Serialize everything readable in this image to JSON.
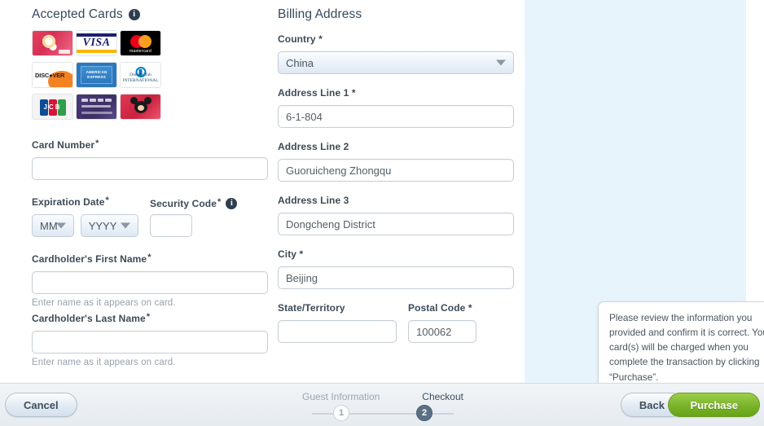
{
  "colors": {
    "accent_green": "#7db52e",
    "step_active": "#5b6f85",
    "panel_blue": "#e8f4fb",
    "label_text": "#3d4a56"
  },
  "payment": {
    "accepted_cards_title": "Accepted Cards",
    "accepted_cards_info_icon": "info-icon",
    "cards": [
      {
        "name": "disney-visa-card",
        "label": "Disney Visa"
      },
      {
        "name": "visa-card",
        "label": "VISA"
      },
      {
        "name": "mastercard-card",
        "label": "mastercard"
      },
      {
        "name": "discover-card",
        "label": "DISCOVER"
      },
      {
        "name": "american-express-card",
        "label": "AMERICAN EXPRESS"
      },
      {
        "name": "diners-club-card",
        "label": "Diners Club INTERNATIONAL"
      },
      {
        "name": "jcb-card",
        "label": "JCB"
      },
      {
        "name": "unionpay-disney-card",
        "label": "UnionPay Disney"
      },
      {
        "name": "disney-mickey-card",
        "label": "Disney Mickey"
      }
    ],
    "card_number_label": "Card Number",
    "card_number_value": "",
    "expiration_date_label": "Expiration Date",
    "exp_month_value": "MM",
    "exp_year_value": "YYYY",
    "security_code_label": "Security Code",
    "security_code_info_icon": "info-icon",
    "security_code_value": "",
    "first_name_label": "Cardholder's First Name",
    "first_name_value": "",
    "first_name_hint": "Enter name as it appears on card.",
    "last_name_label": "Cardholder's Last Name",
    "last_name_value": "",
    "last_name_hint": "Enter name as it appears on card.",
    "required_mark": "*"
  },
  "billing": {
    "title": "Billing Address",
    "country_label": "Country *",
    "country_value": "China",
    "country_caret_icon": "chevron-down-icon",
    "address1_label": "Address Line 1 *",
    "address1_value": "6-1-804",
    "address2_label": "Address Line 2",
    "address2_value": "Guoruicheng Zhongqu",
    "address3_label": "Address Line 3",
    "address3_value": "Dongcheng District",
    "city_label": "City *",
    "city_value": "Beijing",
    "state_label": "State/Territory",
    "state_value": "",
    "postal_label": "Postal Code *",
    "postal_value": "100062"
  },
  "tooltip": {
    "text": "Please review the information you provided and confirm it is correct. Your card(s) will be charged when you complete the transaction by clicking “Purchase”."
  },
  "nav": {
    "cancel_label": "Cancel",
    "back_label": "Back",
    "purchase_label": "Purchase",
    "steps": [
      {
        "label": "Guest Information",
        "number": "1",
        "active": false
      },
      {
        "label": "Checkout",
        "number": "2",
        "active": true
      }
    ]
  }
}
